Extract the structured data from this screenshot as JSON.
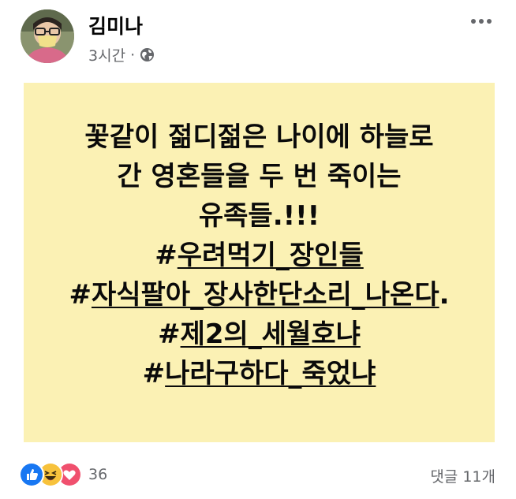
{
  "post": {
    "author": "김미나",
    "time": "3시간",
    "separator": "·",
    "privacy_icon": "globe-icon",
    "more_icon": "more-options-icon"
  },
  "content": {
    "background_color": "#fbf1b4",
    "lines": [
      "꽃같이 젊디젊은 나이에 하늘로",
      "간 영혼들을 두 번 죽이는",
      "유족들.!!!"
    ],
    "hashtags": [
      {
        "prefix": "#",
        "text": "우려먹기_장인들",
        "suffix": ""
      },
      {
        "prefix": "#",
        "text": "자식팔아_장사한단소리_나온다",
        "suffix": "."
      },
      {
        "prefix": "#",
        "text": "제2의_세월호냐",
        "suffix": ""
      },
      {
        "prefix": "#",
        "text": "나라구하다_죽었냐",
        "suffix": ""
      }
    ]
  },
  "footer": {
    "reaction_icons": [
      "like-icon",
      "haha-icon",
      "love-icon"
    ],
    "reaction_count": "36",
    "comments": "댓글 11개"
  }
}
